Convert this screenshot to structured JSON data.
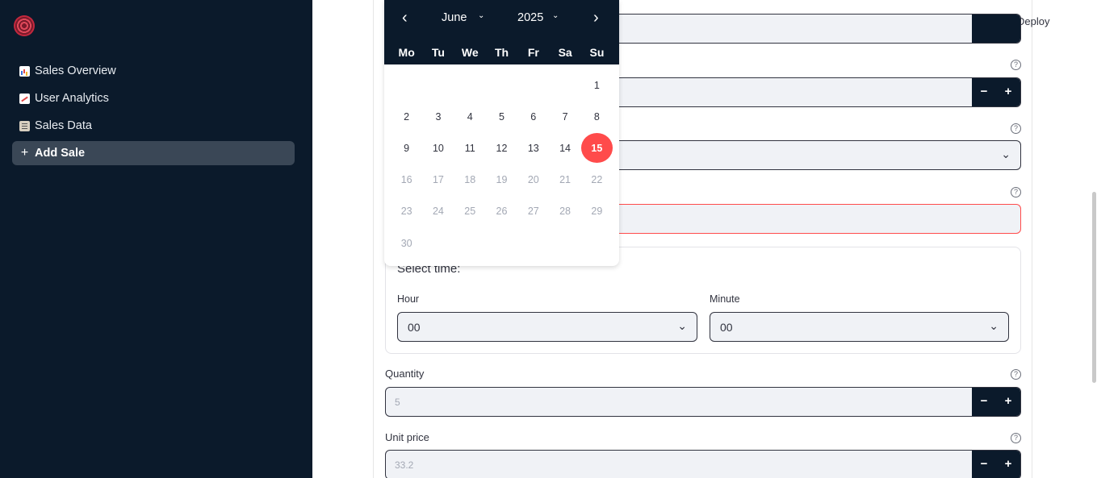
{
  "sidebar": {
    "items": [
      {
        "label": "Sales Overview",
        "icon": "bar-chart-icon"
      },
      {
        "label": "User Analytics",
        "icon": "trend-chart-icon"
      },
      {
        "label": "Sales Data",
        "icon": "clipboard-icon"
      },
      {
        "label": "Add Sale",
        "icon": "plus-icon",
        "active": true
      }
    ]
  },
  "header": {
    "deploy_label": "Deploy"
  },
  "calendar": {
    "month": "June",
    "year": "2025",
    "weekdays": [
      "Mo",
      "Tu",
      "We",
      "Th",
      "Fr",
      "Sa",
      "Su"
    ],
    "weeks": [
      [
        "",
        "",
        "",
        "",
        "",
        "",
        "1"
      ],
      [
        "2",
        "3",
        "4",
        "5",
        "6",
        "7",
        "8"
      ],
      [
        "9",
        "10",
        "11",
        "12",
        "13",
        "14",
        "15"
      ],
      [
        "16",
        "17",
        "18",
        "19",
        "20",
        "21",
        "22"
      ],
      [
        "23",
        "24",
        "25",
        "26",
        "27",
        "28",
        "29"
      ],
      [
        "30",
        "",
        "",
        "",
        "",
        "",
        ""
      ]
    ],
    "selected_day": "15",
    "last_enabled_day": 15
  },
  "time": {
    "title": "Select time:",
    "hour_label": "Hour",
    "hour_value": "00",
    "minute_label": "Minute",
    "minute_value": "00"
  },
  "fields": {
    "quantity_label": "Quantity",
    "quantity_value": "5",
    "unit_price_label": "Unit price",
    "unit_price_value": "33.2"
  },
  "colors": {
    "sidebar_bg": "#0b1a2b",
    "accent": "#ff4b4b",
    "input_bg": "#f0f2f6"
  }
}
